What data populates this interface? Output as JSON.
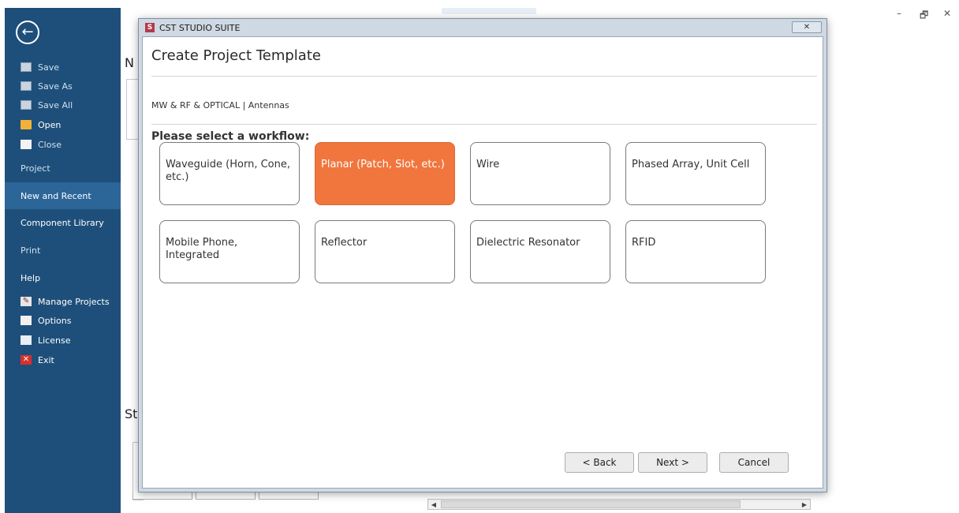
{
  "window": {
    "title": "CST STUDIO SUITE",
    "minimize": "–",
    "restore": "🗗",
    "close": "✕"
  },
  "sidebar": {
    "back_icon": "arrow-left-circle-icon",
    "files": [
      {
        "label": "Save",
        "icon": "save-icon"
      },
      {
        "label": "Save As",
        "icon": "save-as-icon"
      },
      {
        "label": "Save All",
        "icon": "save-all-icon"
      },
      {
        "label": "Open",
        "icon": "folder-open-icon"
      },
      {
        "label": "Close",
        "icon": "close-folder-icon"
      }
    ],
    "sections": [
      "Project",
      "New and Recent",
      "Component Library",
      "Print",
      "Help"
    ],
    "active_section": "New and Recent",
    "tools": [
      {
        "label": "Manage Projects",
        "icon": "manage-projects-icon"
      },
      {
        "label": "Options",
        "icon": "options-icon"
      },
      {
        "label": "License",
        "icon": "license-icon"
      },
      {
        "label": "Exit",
        "icon": "exit-icon"
      }
    ]
  },
  "background": {
    "heading_new": "N",
    "heading_start": "St"
  },
  "dialog": {
    "title_bar": "CST STUDIO SUITE",
    "close_glyph": "✕",
    "title": "Create Project Template",
    "breadcrumb": "MW & RF & OPTICAL | Antennas",
    "subtitle": "Please select a workflow:",
    "workflows": [
      "Waveguide (Horn, Cone, etc.)",
      "Planar (Patch, Slot, etc.)",
      "Wire",
      "Phased Array, Unit Cell",
      "Mobile Phone, Integrated",
      "Reflector",
      "Dielectric Resonator",
      "RFID"
    ],
    "selected_workflow": "Planar (Patch, Slot, etc.)",
    "buttons": {
      "back": "< Back",
      "next": "Next >",
      "cancel": "Cancel"
    }
  },
  "colors": {
    "sidebar": "#1e4f7a",
    "sidebar_active": "#2c6598",
    "selected_tile": "#f0763e"
  }
}
